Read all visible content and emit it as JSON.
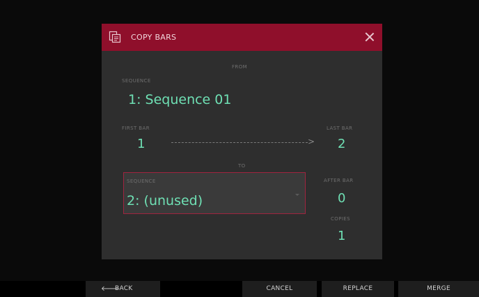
{
  "dialog": {
    "title": "COPY BARS",
    "from_label": "FROM",
    "to_label": "TO",
    "source": {
      "sequence_label": "SEQUENCE",
      "sequence_value": "1: Sequence 01",
      "first_bar_label": "FIRST BAR",
      "first_bar_value": "1",
      "last_bar_label": "LAST BAR",
      "last_bar_value": "2"
    },
    "destination": {
      "sequence_label": "SEQUENCE",
      "sequence_value": "2: (unused)",
      "after_bar_label": "AFTER BAR",
      "after_bar_value": "0",
      "copies_label": "COPIES",
      "copies_value": "1"
    }
  },
  "bottom_bar": {
    "back_arrow": "🡐",
    "back_label": "BACK",
    "cancel_label": "CANCEL",
    "replace_label": "REPLACE",
    "merge_label": "MERGE"
  },
  "colors": {
    "header": "#8f0f2b",
    "value_text": "#6fe0b4",
    "dialog_bg": "#2e2e2e",
    "selection_border": "#a0243f"
  },
  "icons": {
    "header_icon": "copy-bars-icon",
    "close_icon": "close-icon",
    "back_icon": "arrow-left-icon"
  }
}
